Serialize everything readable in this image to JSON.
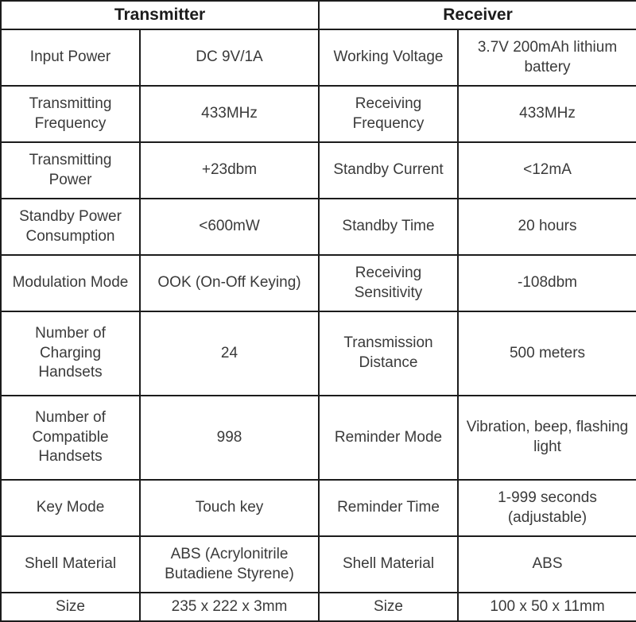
{
  "table": {
    "headers": [
      {
        "label": "Transmitter",
        "span": 2
      },
      {
        "label": "Receiver",
        "span": 2
      }
    ],
    "rows": [
      {
        "height": "tall",
        "tx_param": "Input Power",
        "tx_value": "DC 9V/1A",
        "rx_param": "Working Voltage",
        "rx_value": "3.7V 200mAh lithium battery"
      },
      {
        "height": "tall",
        "tx_param": "Transmitting Frequency",
        "tx_value": "433MHz",
        "rx_param": "Receiving Frequency",
        "rx_value": "433MHz"
      },
      {
        "height": "tall",
        "tx_param": "Transmitting Power",
        "tx_value": "+23dbm",
        "rx_param": "Standby Current",
        "rx_value": "<12mA"
      },
      {
        "height": "tall",
        "tx_param": "Standby Power Consumption",
        "tx_value": "<600mW",
        "rx_param": "Standby Time",
        "rx_value": "20 hours"
      },
      {
        "height": "tall",
        "tx_param": "Modulation Mode",
        "tx_value": "OOK (On-Off Keying)",
        "rx_param": "Receiving Sensitivity",
        "rx_value": "-108dbm"
      },
      {
        "height": "xtall",
        "tx_param": "Number of Charging Handsets",
        "tx_value": "24",
        "rx_param": "Transmission Distance",
        "rx_value": "500 meters"
      },
      {
        "height": "xtall",
        "tx_param": "Number of Compatible Handsets",
        "tx_value": "998",
        "rx_param": "Reminder Mode",
        "rx_value": "Vibration, beep, flashing light"
      },
      {
        "height": "tall",
        "tx_param": "Key Mode",
        "tx_value": "Touch key",
        "rx_param": "Reminder Time",
        "rx_value": "1-999 seconds (adjustable)"
      },
      {
        "height": "tall",
        "tx_param": "Shell Material",
        "tx_value": "ABS (Acrylonitrile Butadiene Styrene)",
        "rx_param": "Shell Material",
        "rx_value": "ABS"
      },
      {
        "height": "short",
        "tx_param": "Size",
        "tx_value": "235 x 222 x 3mm",
        "rx_param": "Size",
        "rx_value": "100 x 50 x 11mm"
      }
    ]
  },
  "colors": {
    "border": "#1c1c1c",
    "text": "#3a3a3a",
    "header_text": "#1c1c1c",
    "background": "#ffffff"
  }
}
